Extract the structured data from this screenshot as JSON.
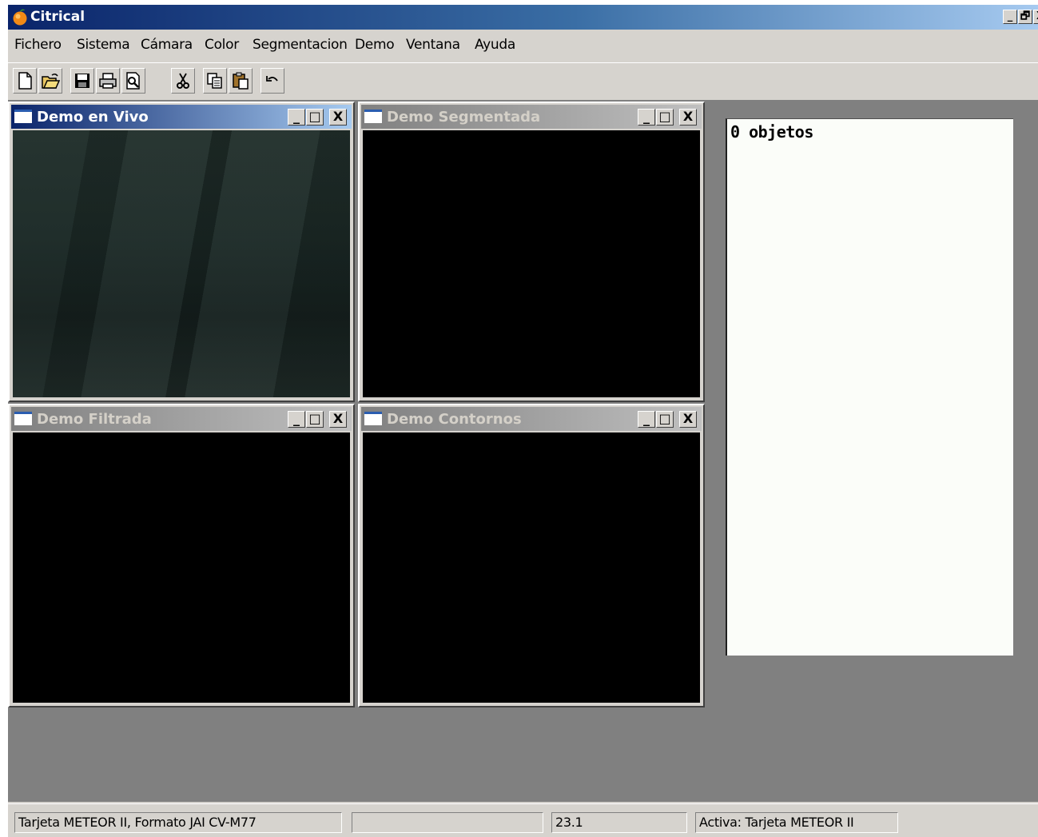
{
  "window": {
    "title": "Citrical",
    "buttons": [
      "_",
      "🗗",
      "X"
    ]
  },
  "menu": {
    "items": [
      "Fichero",
      "Sistema",
      "Cámara",
      "Color",
      "Segmentacion",
      "Demo",
      "Ventana",
      "Ayuda"
    ]
  },
  "toolbar": {
    "buttons": [
      "new-icon",
      "open-icon",
      "save-icon",
      "print-icon",
      "print-preview-icon",
      "cut-icon",
      "copy-icon",
      "paste-icon",
      "undo-icon"
    ]
  },
  "children": [
    {
      "title": "Demo en Vivo",
      "active": true
    },
    {
      "title": "Demo Segmentada",
      "active": false
    },
    {
      "title": "Demo Filtrada",
      "active": false
    },
    {
      "title": "Demo Contornos",
      "active": false
    }
  ],
  "child_buttons": {
    "minimize": "_",
    "maximize": "□",
    "close": "X"
  },
  "objects_panel": {
    "count_text": "0 objetos"
  },
  "statusbar": {
    "pane1": "Tarjeta METEOR II, Formato JAI CV-M77",
    "pane2": "",
    "pane3": "23.1",
    "pane4": "Activa: Tarjeta METEOR II"
  },
  "colors": {
    "title_active_start": "#0a246a",
    "title_active_end": "#a6caf0",
    "title_inactive_start": "#808080",
    "mdi_background": "#808080",
    "face": "#d6d3ce"
  }
}
